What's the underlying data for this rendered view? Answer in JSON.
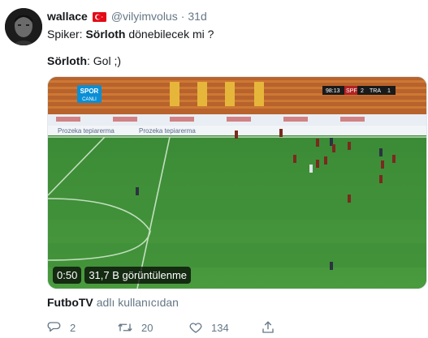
{
  "author": {
    "name": "wallace",
    "handle": "@vilyimvolus",
    "separator": "·",
    "time": "31d",
    "flag_icon": "turkey-flag-icon"
  },
  "tweet": {
    "line1_prefix": "Spiker: ",
    "line1_bold": "Sörloth",
    "line1_suffix": " dönebilecek mi ?",
    "line2_bold": "Sörloth",
    "line2_suffix": ": Gol ;)"
  },
  "video": {
    "duration": "0:50",
    "views": "31,7 B görüntülenme",
    "scoreboard_time": "98:13",
    "team_home": "SPF",
    "score_home": "2",
    "team_away": "TRA",
    "score_away": "1",
    "broadcaster_logo_line1": "SPOR",
    "broadcaster_logo_line2": "CANLI",
    "board_ad_text": "Prozeka tepiarerma"
  },
  "attribution": {
    "source": "FutboTV",
    "suffix": "adlı kullanıcıdan"
  },
  "actions": {
    "replies": "2",
    "retweets": "20",
    "likes": "134"
  },
  "colors": {
    "accent": "#1da1f2",
    "muted": "#657786",
    "text": "#14171a"
  }
}
